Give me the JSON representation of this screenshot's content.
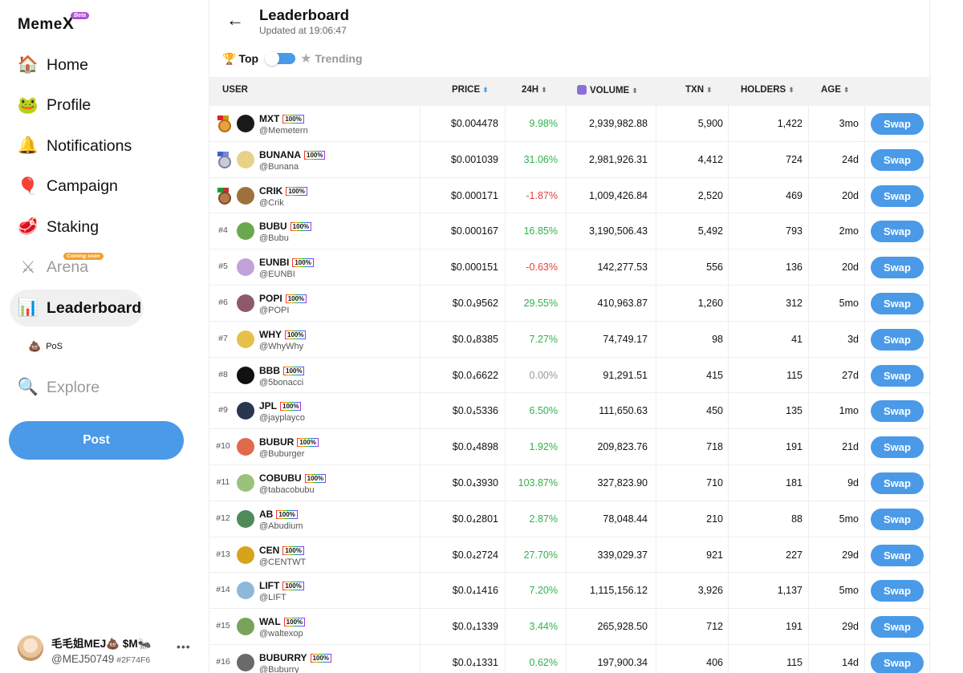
{
  "app": {
    "logo": "Meme",
    "logo_x": "X",
    "beta": "Beta"
  },
  "sidebar": {
    "items": [
      {
        "label": "Home",
        "icon": "house-icon",
        "glyph": "🏠"
      },
      {
        "label": "Profile",
        "icon": "frog-icon",
        "glyph": "🐸"
      },
      {
        "label": "Notifications",
        "icon": "bell-icon",
        "glyph": "🔔"
      },
      {
        "label": "Campaign",
        "icon": "balloon-icon",
        "glyph": "🎈"
      },
      {
        "label": "Staking",
        "icon": "steak-icon",
        "glyph": "🥩"
      },
      {
        "label": "Arena",
        "icon": "swords-icon",
        "glyph": "⚔",
        "badge": "Coming soon"
      },
      {
        "label": "Leaderboard",
        "icon": "podium-icon",
        "glyph": "📊"
      },
      {
        "label": "Explore",
        "icon": "magnifier-icon",
        "glyph": "🔍"
      }
    ],
    "pos": {
      "label": "PoS",
      "glyph": "💩"
    },
    "post_label": "Post",
    "user": {
      "name": "毛毛姐MEJ💩 $M🐜",
      "handle": "@MEJ50749",
      "code": "#2F74F6",
      "more": "•••"
    }
  },
  "header": {
    "back": "←",
    "title": "Leaderboard",
    "updated": "Updated at 19:06:47"
  },
  "toggle": {
    "top_label": "Top",
    "trophy": "🏆",
    "trending_label": "Trending",
    "star": "★"
  },
  "table": {
    "columns": {
      "user": "USER",
      "price": "PRICE",
      "change": "24H",
      "volume": "VOLUME",
      "txn": "TXN",
      "holders": "HOLDERS",
      "age": "AGE"
    },
    "sort_glyph": "⬍",
    "swap_label": "Swap",
    "badge": "100%",
    "rows": [
      {
        "rank": "",
        "medal": "gold",
        "symbol": "MXT",
        "handle": "@Memetern",
        "price": "$0.004478",
        "change": "9.98%",
        "dir": "up",
        "volume": "2,939,982.88",
        "txn": "5,900",
        "holders": "1,422",
        "age": "3mo",
        "color": "#1a1a1a"
      },
      {
        "rank": "",
        "medal": "silver",
        "symbol": "BUNANA",
        "handle": "@Bunana",
        "price": "$0.001039",
        "change": "31.06%",
        "dir": "up",
        "volume": "2,981,926.31",
        "txn": "4,412",
        "holders": "724",
        "age": "24d",
        "color": "#e8d28a"
      },
      {
        "rank": "",
        "medal": "bronze",
        "symbol": "CRIK",
        "handle": "@Crik",
        "price": "$0.000171",
        "change": "-1.87%",
        "dir": "down",
        "volume": "1,009,426.84",
        "txn": "2,520",
        "holders": "469",
        "age": "20d",
        "color": "#a0703c"
      },
      {
        "rank": "#4",
        "medal": "",
        "symbol": "BUBU",
        "handle": "@Bubu",
        "price": "$0.000167",
        "change": "16.85%",
        "dir": "up",
        "volume": "3,190,506.43",
        "txn": "5,492",
        "holders": "793",
        "age": "2mo",
        "color": "#6aa84f"
      },
      {
        "rank": "#5",
        "medal": "",
        "symbol": "EUNBI",
        "handle": "@EUNBI",
        "price": "$0.000151",
        "change": "-0.63%",
        "dir": "down",
        "volume": "142,277.53",
        "txn": "556",
        "holders": "136",
        "age": "20d",
        "color": "#c2a3d8"
      },
      {
        "rank": "#6",
        "medal": "",
        "symbol": "POPI",
        "handle": "@POPI",
        "price": "$0.0₄9562",
        "change": "29.55%",
        "dir": "up",
        "volume": "410,963.87",
        "txn": "1,260",
        "holders": "312",
        "age": "5mo",
        "color": "#8e5a6a"
      },
      {
        "rank": "#7",
        "medal": "",
        "symbol": "WHY",
        "handle": "@WhyWhy",
        "price": "$0.0₄8385",
        "change": "7.27%",
        "dir": "up",
        "volume": "74,749.17",
        "txn": "98",
        "holders": "41",
        "age": "3d",
        "color": "#e6c04a"
      },
      {
        "rank": "#8",
        "medal": "",
        "symbol": "BBB",
        "handle": "@5bonacci",
        "price": "$0.0₄6622",
        "change": "0.00%",
        "dir": "flat",
        "volume": "91,291.51",
        "txn": "415",
        "holders": "115",
        "age": "27d",
        "color": "#111111"
      },
      {
        "rank": "#9",
        "medal": "",
        "symbol": "JPL",
        "handle": "@jayplayco",
        "price": "$0.0₄5336",
        "change": "6.50%",
        "dir": "up",
        "volume": "111,650.63",
        "txn": "450",
        "holders": "135",
        "age": "1mo",
        "color": "#2a3550"
      },
      {
        "rank": "#10",
        "medal": "",
        "symbol": "BUBUR",
        "handle": "@Buburger",
        "price": "$0.0₄4898",
        "change": "1.92%",
        "dir": "up",
        "volume": "209,823.76",
        "txn": "718",
        "holders": "191",
        "age": "21d",
        "color": "#e06a4a"
      },
      {
        "rank": "#11",
        "medal": "",
        "symbol": "COBUBU",
        "handle": "@tabacobubu",
        "price": "$0.0₄3930",
        "change": "103.87%",
        "dir": "up",
        "volume": "327,823.90",
        "txn": "710",
        "holders": "181",
        "age": "9d",
        "color": "#9bc27a"
      },
      {
        "rank": "#12",
        "medal": "",
        "symbol": "AB",
        "handle": "@Abudium",
        "price": "$0.0₄2801",
        "change": "2.87%",
        "dir": "up",
        "volume": "78,048.44",
        "txn": "210",
        "holders": "88",
        "age": "5mo",
        "color": "#4f8a5b"
      },
      {
        "rank": "#13",
        "medal": "",
        "symbol": "CEN",
        "handle": "@CENTWT",
        "price": "$0.0₄2724",
        "change": "27.70%",
        "dir": "up",
        "volume": "339,029.37",
        "txn": "921",
        "holders": "227",
        "age": "29d",
        "color": "#d9a21b"
      },
      {
        "rank": "#14",
        "medal": "",
        "symbol": "LIFT",
        "handle": "@LIFT",
        "price": "$0.0₄1416",
        "change": "7.20%",
        "dir": "up",
        "volume": "1,115,156.12",
        "txn": "3,926",
        "holders": "1,137",
        "age": "5mo",
        "color": "#8fb7d8"
      },
      {
        "rank": "#15",
        "medal": "",
        "symbol": "WAL",
        "handle": "@waltexop",
        "price": "$0.0₄1339",
        "change": "3.44%",
        "dir": "up",
        "volume": "265,928.50",
        "txn": "712",
        "holders": "191",
        "age": "29d",
        "color": "#7aa35a"
      },
      {
        "rank": "#16",
        "medal": "",
        "symbol": "BUBURRY",
        "handle": "@Buburry",
        "price": "$0.0₄1331",
        "change": "0.62%",
        "dir": "up",
        "volume": "197,900.34",
        "txn": "406",
        "holders": "115",
        "age": "14d",
        "color": "#6a6a6a"
      }
    ]
  }
}
